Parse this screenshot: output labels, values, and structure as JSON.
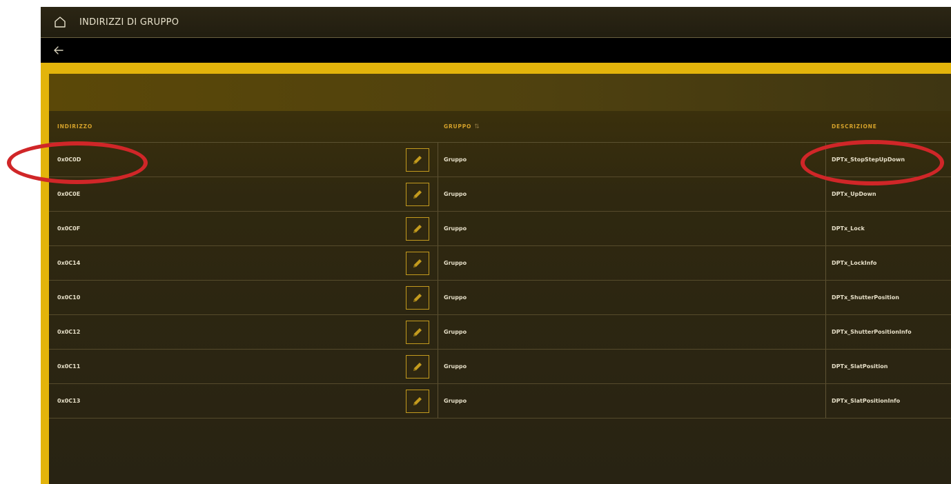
{
  "window": {
    "title": "INDIRIZZI DI GRUPPO",
    "home_icon": "home-icon",
    "back_icon": "back-arrow-icon"
  },
  "table": {
    "headers": {
      "address": "INDIRIZZO",
      "group": "GRUPPO",
      "group_sort_icon": "sort-icon",
      "description": "DESCRIZIONE"
    },
    "rows": [
      {
        "address": "0x0C0D",
        "group": "Gruppo",
        "description": "DPTx_StopStepUpDown"
      },
      {
        "address": "0x0C0E",
        "group": "Gruppo",
        "description": "DPTx_UpDown"
      },
      {
        "address": "0x0C0F",
        "group": "Gruppo",
        "description": "DPTx_Lock"
      },
      {
        "address": "0x0C14",
        "group": "Gruppo",
        "description": "DPTx_LockInfo"
      },
      {
        "address": "0x0C10",
        "group": "Gruppo",
        "description": "DPTx_ShutterPosition"
      },
      {
        "address": "0x0C12",
        "group": "Gruppo",
        "description": "DPTx_ShutterPositionInfo"
      },
      {
        "address": "0x0C11",
        "group": "Gruppo",
        "description": "DPTx_SlatPosition"
      },
      {
        "address": "0x0C13",
        "group": "Gruppo",
        "description": "DPTx_SlatPositionInfo"
      }
    ],
    "edit_icon": "pencil-icon"
  },
  "colors": {
    "accent_yellow": "#e3b40b",
    "header_text": "#d4a12a",
    "annotation_red": "#d02628"
  }
}
